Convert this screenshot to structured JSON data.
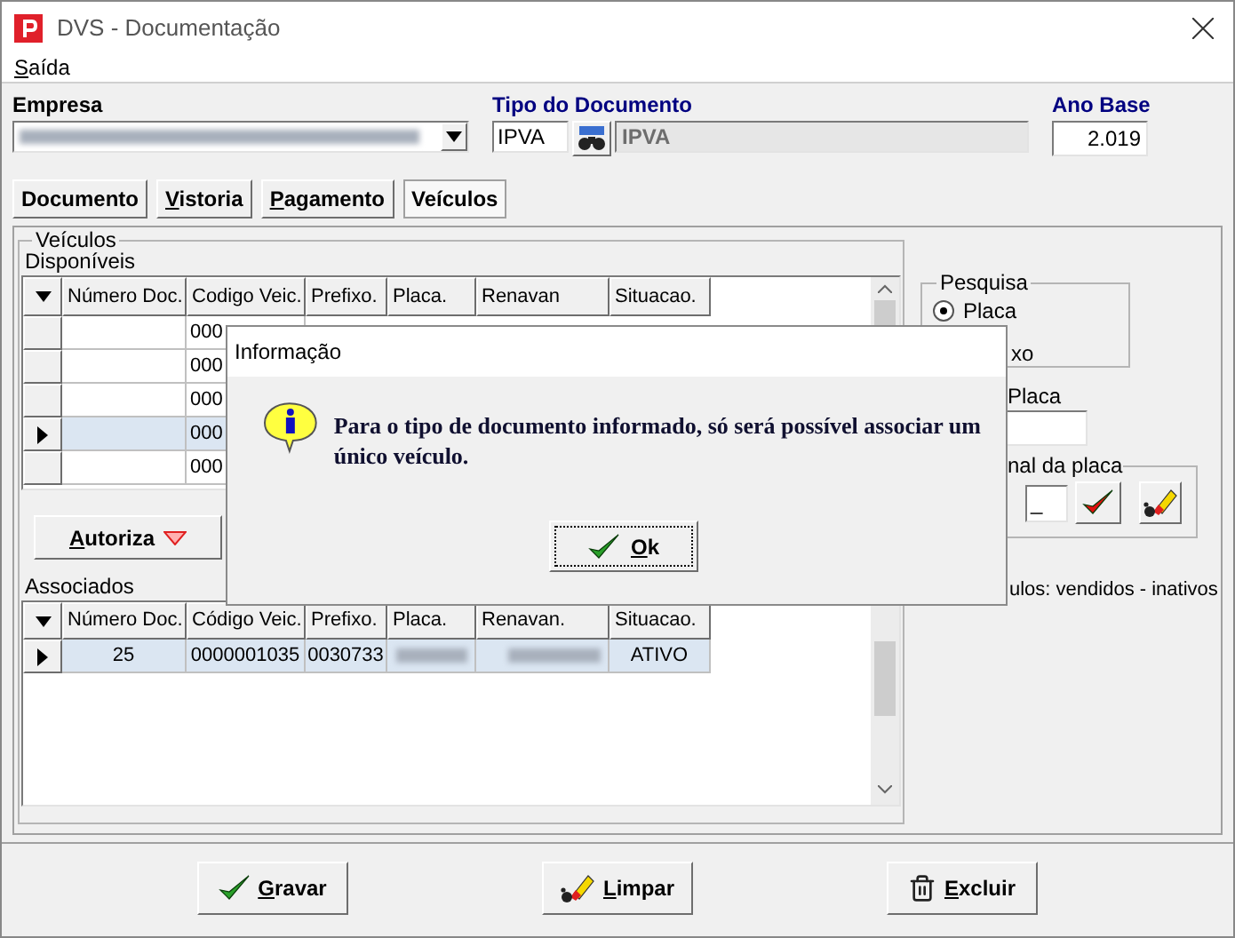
{
  "window": {
    "title": "DVS - Documentação"
  },
  "menu": [
    {
      "label": "Saída",
      "mnemonic": true
    }
  ],
  "header": {
    "empresa": {
      "label": "Empresa"
    },
    "tipo_documento": {
      "label": "Tipo do Documento",
      "code": "IPVA",
      "description": "IPVA"
    },
    "ano_base": {
      "label": "Ano Base",
      "value": "2.019"
    }
  },
  "tabs": [
    {
      "label": "Documento",
      "selected": false,
      "mnemonic": false
    },
    {
      "label": "Vistoria",
      "selected": false,
      "mnemonic": true
    },
    {
      "label": "Pagamento",
      "selected": false,
      "mnemonic": true
    },
    {
      "label": "Veículos",
      "selected": true,
      "mnemonic": false
    }
  ],
  "vehicles": {
    "title": "Veículos",
    "available": {
      "label": "Disponíveis",
      "columns": [
        "Número Doc.",
        "Codigo Veic.",
        "Prefixo.",
        "Placa.",
        "Renavan",
        "Situacao."
      ],
      "rows": [
        {
          "codigo": "000",
          "selected": false
        },
        {
          "codigo": "000",
          "selected": false
        },
        {
          "codigo": "000",
          "selected": false
        },
        {
          "codigo": "000",
          "selected": true
        },
        {
          "codigo": "000",
          "selected": false
        }
      ]
    },
    "authorize_button": {
      "label": "Autoriza",
      "mnemonic": true
    },
    "associated": {
      "label": "Associados",
      "columns": [
        "Número Doc.",
        "Código Veic.",
        "Prefixo.",
        "Placa.",
        "Renavan.",
        "Situacao."
      ],
      "rows": [
        {
          "numero": "25",
          "codigo": "0000001035",
          "prefixo": "0030733",
          "situacao": "ATIVO",
          "selected": true
        }
      ]
    }
  },
  "search": {
    "title": "Pesquisa",
    "options": [
      {
        "label": "Placa",
        "selected": true
      }
    ],
    "partial_option": "xo",
    "plate_label": "Placa",
    "final_group": {
      "title": "nal da placa",
      "value": "_"
    },
    "note": "ulos: vendidos - inativos"
  },
  "actions": [
    {
      "label": "Gravar",
      "kind": "check",
      "mnemonic": true
    },
    {
      "label": "Limpar",
      "kind": "eraser",
      "mnemonic": true
    },
    {
      "label": "Excluir",
      "kind": "trash",
      "mnemonic": true
    }
  ],
  "dialog": {
    "title": "Informação",
    "message": "Para o tipo de documento informado, só será possível associar um único veículo.",
    "button": {
      "label": "Ok",
      "mnemonic": true
    }
  }
}
